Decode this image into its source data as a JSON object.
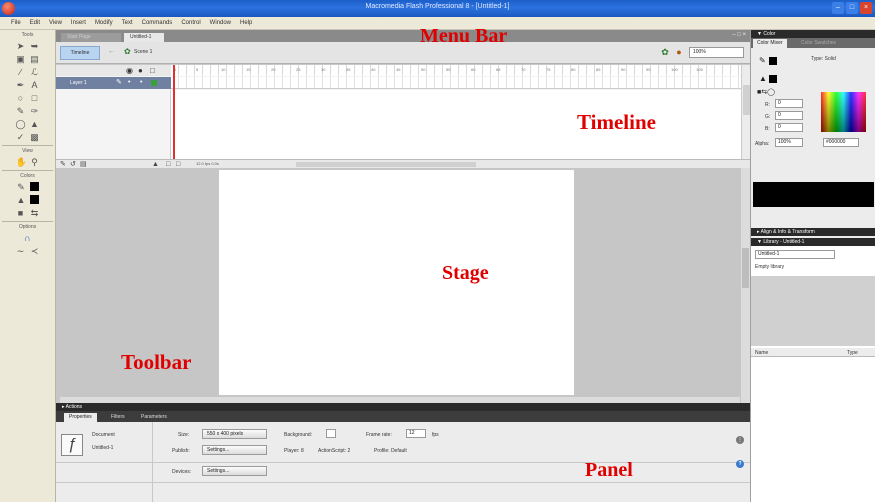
{
  "window": {
    "title": "Macromedia Flash Professional 8 - [Untitled-1]",
    "controls": [
      "minimize",
      "maximize",
      "close"
    ]
  },
  "menubar": {
    "items": [
      "File",
      "Edit",
      "View",
      "Insert",
      "Modify",
      "Text",
      "Commands",
      "Control",
      "Window",
      "Help"
    ]
  },
  "captions": {
    "menu_bar": "Menu Bar",
    "timeline": "Timeline",
    "stage": "Stage",
    "toolbar": "Toolbar",
    "panel": "Panel"
  },
  "tools": {
    "header": "Tools",
    "view_header": "View",
    "colors_header": "Colors",
    "options_header": "Options",
    "icons": [
      "selection-icon",
      "subselection-icon",
      "free-transform-icon",
      "fill-transform-icon",
      "line-icon",
      "lasso-icon",
      "pen-icon",
      "text-icon",
      "oval-icon",
      "rectangle-icon",
      "pencil-icon",
      "brush-icon",
      "ink-bottle-icon",
      "paint-bucket-icon",
      "eyedropper-icon",
      "eraser-icon",
      "hand-icon",
      "zoom-icon"
    ]
  },
  "document": {
    "tabs": [
      "Start Page",
      "Untitled-1"
    ],
    "timeline_button": "Timeline",
    "scene": "Scene 1",
    "zoom": "100%",
    "layer_name": "Layer 1",
    "status": "12.0 fps   0.0s",
    "frame_labels": [
      "1",
      "5",
      "10",
      "15",
      "20",
      "25",
      "30",
      "35",
      "40",
      "45",
      "50",
      "55",
      "60",
      "65",
      "70",
      "75",
      "80",
      "85",
      "90",
      "95",
      "100",
      "105"
    ]
  },
  "panel": {
    "actions_title": "▸ Actions",
    "tabs": [
      "Properties",
      "Filters",
      "Parameters"
    ],
    "doc_label": "Document",
    "doc_name": "Untitled-1",
    "size_label": "Size:",
    "size_value": "550 x 400 pixels",
    "background_label": "Background:",
    "frame_rate_label": "Frame rate:",
    "frame_rate_value": "12",
    "fps_label": "fps",
    "publish_label": "Publish:",
    "publish_settings": "Settings...",
    "player_label": "Player: 8",
    "actionscript_label": "ActionScript: 2",
    "profile_label": "Profile: Default",
    "devices_label": "Devices:",
    "devices_settings": "Settings..."
  },
  "right_panel": {
    "color_title": "▼ Color",
    "color_tabs": [
      "Color Mixer",
      "Color Swatches"
    ],
    "type_label": "Type: Solid",
    "r_label": "R:",
    "r_value": "0",
    "g_label": "G:",
    "g_value": "0",
    "b_label": "B:",
    "b_value": "0",
    "alpha_label": "Alpha:",
    "alpha_value": "100%",
    "hex_value": "#000000",
    "align_title": "▸ Align & Info & Transform",
    "library_title": "▼ Library - Untitled-1",
    "library_select": "Untitled-1",
    "library_status": "Empty library",
    "col_name": "Name",
    "col_type": "Type"
  },
  "colors": {
    "title_bar": "#1c5fc8",
    "caption_red": "#e00000",
    "stage_bg": "#ffffff",
    "work_area": "#c6c6c6"
  }
}
